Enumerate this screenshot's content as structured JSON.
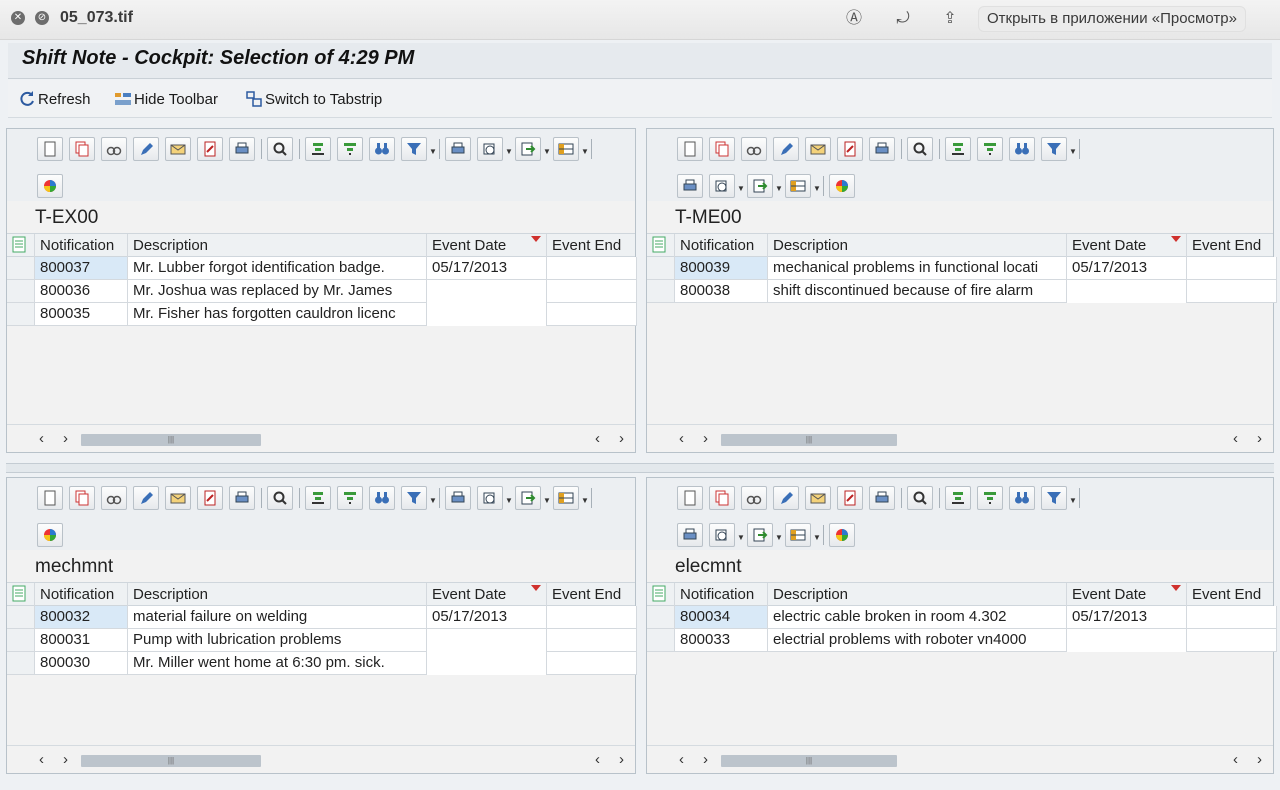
{
  "window": {
    "filename": "05_073.tif",
    "open_in_app": "Открыть в приложении «Просмотр»"
  },
  "sap": {
    "title": "Shift Note - Cockpit: Selection of 4:29 PM",
    "toolbar": {
      "refresh": "Refresh",
      "hide_toolbar": "Hide Toolbar",
      "switch_tabstrip": "Switch to Tabstrip"
    }
  },
  "columns": {
    "notification": "Notification",
    "description": "Description",
    "event_date": "Event Date",
    "event_end": "Event End"
  },
  "panels": [
    {
      "title": "T-EX00",
      "rows": [
        {
          "notification": "800037",
          "description": "Mr. Lubber forgot identification badge.",
          "event_date": "05/17/2013"
        },
        {
          "notification": "800036",
          "description": "Mr. Joshua was replaced by Mr. James",
          "event_date": ""
        },
        {
          "notification": "800035",
          "description": "Mr. Fisher has forgotten cauldron licenc",
          "event_date": ""
        }
      ]
    },
    {
      "title": "T-ME00",
      "rows": [
        {
          "notification": "800039",
          "description": "mechanical problems in functional locati",
          "event_date": "05/17/2013"
        },
        {
          "notification": "800038",
          "description": "shift discontinued because of fire alarm",
          "event_date": ""
        }
      ]
    },
    {
      "title": "mechmnt",
      "rows": [
        {
          "notification": "800032",
          "description": "material failure on welding",
          "event_date": "05/17/2013"
        },
        {
          "notification": "800031",
          "description": "Pump with lubrication problems",
          "event_date": ""
        },
        {
          "notification": "800030",
          "description": "Mr. Miller went home at 6:30 pm. sick.",
          "event_date": ""
        }
      ]
    },
    {
      "title": "elecmnt",
      "rows": [
        {
          "notification": "800034",
          "description": "electric cable broken in room 4.302",
          "event_date": "05/17/2013"
        },
        {
          "notification": "800033",
          "description": "electrial problems with roboter vn4000",
          "event_date": ""
        }
      ]
    }
  ],
  "colors": {
    "selected_cell": "#d9e9f7",
    "sort_indicator": "#d0312d"
  }
}
